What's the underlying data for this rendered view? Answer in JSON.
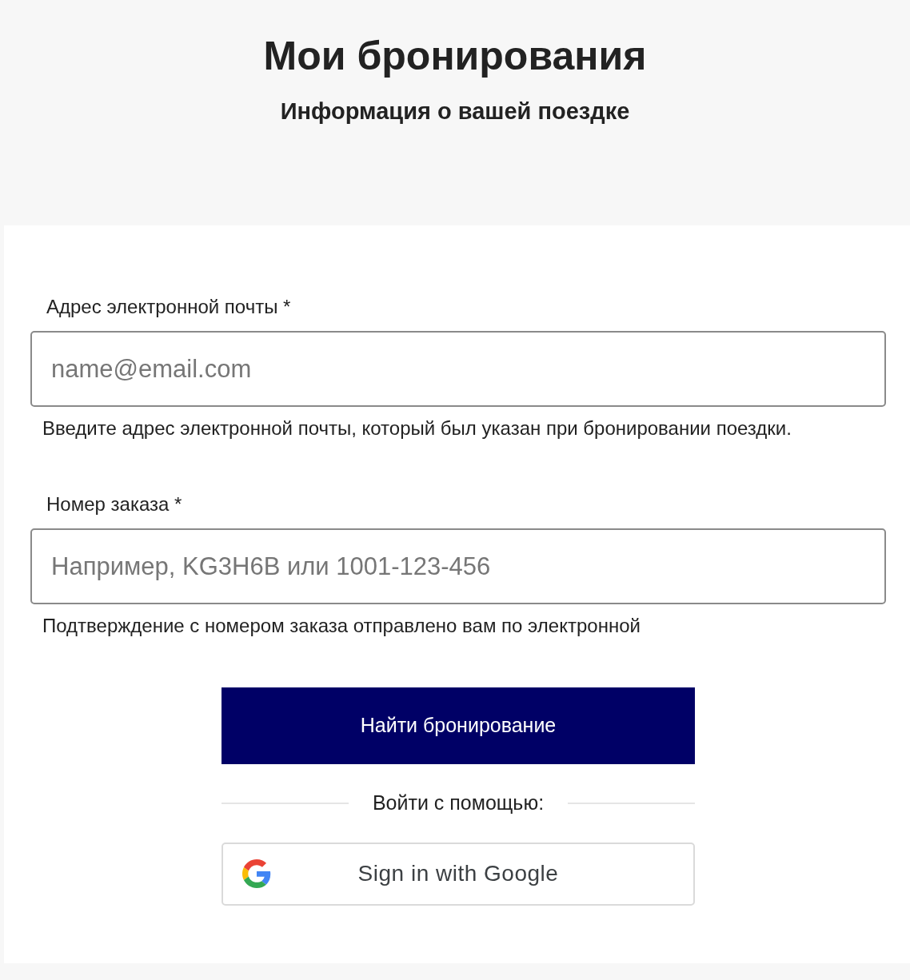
{
  "header": {
    "title": "Мои бронирования",
    "subtitle": "Информация о вашей поездке"
  },
  "fields": [
    {
      "label": "Адрес электронной почты *",
      "placeholder": "name@email.com",
      "help": "Введите адрес электронной почты, который был указан при бронировании поездки."
    },
    {
      "label": "Номер заказа *",
      "placeholder": "Например, KG3H6B или 1001-123-456",
      "help": "Подтверждение с номером заказа отправлено вам по электронной"
    }
  ],
  "submit_button": "Найти бронирование",
  "divider_text": "Войти с помощью:",
  "google_button": "Sign in with Google"
}
